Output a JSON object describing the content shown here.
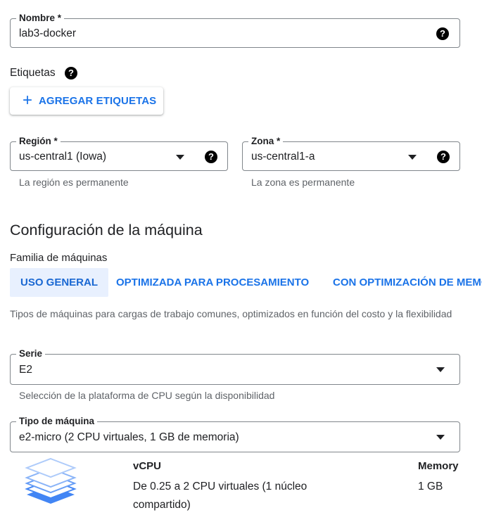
{
  "name_field": {
    "label": "Nombre *",
    "value": "lab3-docker",
    "help_icon": "help-icon"
  },
  "labels": {
    "title": "Etiquetas",
    "help_icon": "help-icon",
    "add_button": {
      "icon": "plus-icon",
      "label": "AGREGAR ETIQUETAS"
    }
  },
  "region_field": {
    "label": "Región *",
    "value": "us-central1 (Iowa)",
    "hint": "La región es permanente"
  },
  "zone_field": {
    "label": "Zona *",
    "value": "us-central1-a",
    "hint": "La zona es permanente"
  },
  "machine_config": {
    "heading": "Configuración de la máquina",
    "family_label": "Familia de máquinas",
    "tabs": [
      {
        "label": "USO GENERAL",
        "selected": true
      },
      {
        "label": "OPTIMIZADA PARA PROCESAMIENTO",
        "selected": false
      },
      {
        "label": "CON OPTIMIZACIÓN DE MEMORIA",
        "selected": false
      }
    ],
    "description": "Tipos de máquinas para cargas de trabajo comunes, optimizados en función del costo y la flexibilidad"
  },
  "series_field": {
    "label": "Serie",
    "value": "E2",
    "hint": "Selección de la plataforma de CPU según la disponibilidad"
  },
  "machine_type_field": {
    "label": "Tipo de máquina",
    "value": "e2-micro (2 CPU virtuales, 1 GB de memoria)"
  },
  "specs": {
    "icon": "stacked-layers-icon",
    "vcpu_header": "vCPU",
    "vcpu_value": "De 0.25 a 2 CPU virtuales (1 núcleo compartido)",
    "memory_header": "Memory",
    "memory_value": "1 GB"
  },
  "colors": {
    "accent": "#1a73e8",
    "tab_selected_bg": "#e8f0fe",
    "icon_blue_dark": "#4285f4",
    "icon_blue_light": "#aecbfa"
  }
}
